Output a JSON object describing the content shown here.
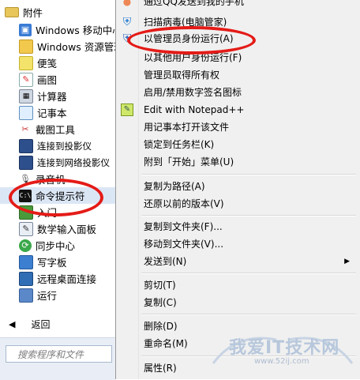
{
  "start_menu": {
    "folder_label": "附件",
    "items": [
      {
        "label": "Windows 移动中心",
        "icon": "mobility-center-icon"
      },
      {
        "label": "Windows 资源管理",
        "icon": "explorer-icon"
      },
      {
        "label": "便笺",
        "icon": "sticky-notes-icon"
      },
      {
        "label": "画图",
        "icon": "paint-icon"
      },
      {
        "label": "计算器",
        "icon": "calculator-icon"
      },
      {
        "label": "记事本",
        "icon": "notepad-icon"
      },
      {
        "label": "截图工具",
        "icon": "snipping-tool-icon"
      },
      {
        "label": "连接到投影仪",
        "icon": "projector-icon"
      },
      {
        "label": "连接到网络投影仪",
        "icon": "network-projector-icon"
      },
      {
        "label": "录音机",
        "icon": "sound-recorder-icon"
      },
      {
        "label": "命令提示符",
        "icon": "command-prompt-icon"
      },
      {
        "label": "入门",
        "icon": "getting-started-icon"
      },
      {
        "label": "数学输入面板",
        "icon": "math-input-icon"
      },
      {
        "label": "同步中心",
        "icon": "sync-center-icon"
      },
      {
        "label": "写字板",
        "icon": "wordpad-icon"
      },
      {
        "label": "远程桌面连接",
        "icon": "remote-desktop-icon"
      },
      {
        "label": "运行",
        "icon": "run-icon"
      }
    ],
    "back_label": "返回",
    "search_placeholder": "搜索程序和文件"
  },
  "context_menu": {
    "items": [
      {
        "label": "通过QQ发送到我的手机",
        "icon": "qq-icon"
      },
      {
        "label": "扫描病毒(电脑管家)",
        "icon": "pc-manager-shield-icon"
      },
      {
        "label": "以管理员身份运行(A)",
        "icon": "uac-shield-icon"
      },
      {
        "label": "以其他用户身份运行(F)"
      },
      {
        "label": "管理员取得所有权"
      },
      {
        "label": "启用/禁用数字签名图标"
      },
      {
        "label": "Edit with Notepad++",
        "icon": "notepad-plus-plus-icon"
      },
      {
        "label": "用记事本打开该文件"
      },
      {
        "label": "锁定到任务栏(K)"
      },
      {
        "label": "附到「开始」菜单(U)"
      },
      {
        "label": "复制为路径(A)"
      },
      {
        "label": "还原以前的版本(V)"
      },
      {
        "label": "复制到文件夹(F)..."
      },
      {
        "label": "移动到文件夹(V)..."
      },
      {
        "label": "发送到(N)",
        "submenu": true
      },
      {
        "label": "剪切(T)"
      },
      {
        "label": "复制(C)"
      },
      {
        "label": "删除(D)"
      },
      {
        "label": "重命名(M)"
      },
      {
        "label": "属性(R)"
      }
    ]
  },
  "watermark": {
    "title": "我爱IT技术网",
    "url": "www.52ij.com"
  },
  "colors": {
    "highlight_oval": "#e41b17",
    "selected_row": "#dbe6f5"
  }
}
